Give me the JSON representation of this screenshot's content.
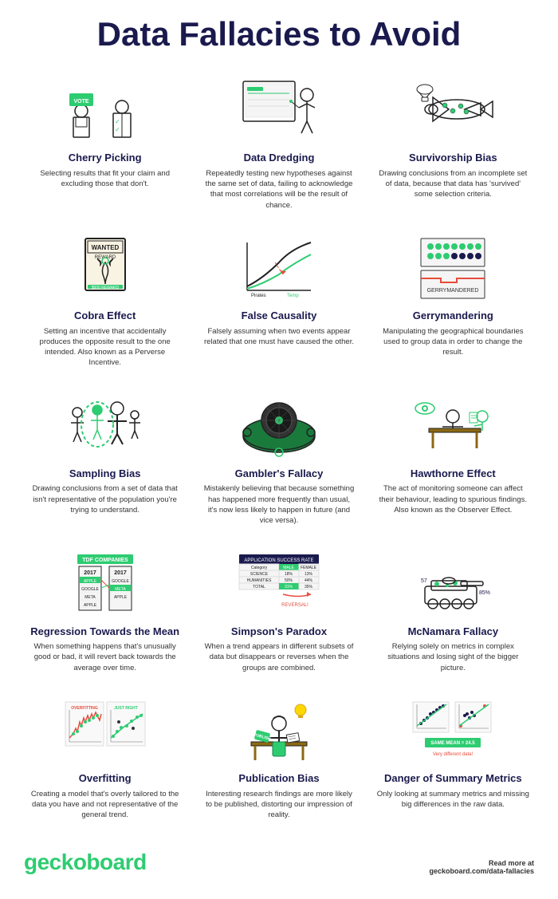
{
  "title": "Data Fallacies to Avoid",
  "cards": [
    {
      "id": "cherry-picking",
      "title": "Cherry Picking",
      "desc": "Selecting results that fit your claim and excluding those that don't."
    },
    {
      "id": "data-dredging",
      "title": "Data Dredging",
      "desc": "Repeatedly testing new hypotheses against the same set of data, failing to acknowledge that most correlations will be the result of chance."
    },
    {
      "id": "survivorship-bias",
      "title": "Survivorship Bias",
      "desc": "Drawing conclusions from an incomplete set of data, because that data has 'survived' some selection criteria."
    },
    {
      "id": "cobra-effect",
      "title": "Cobra Effect",
      "desc": "Setting an incentive that accidentally produces the opposite result to the one intended. Also known as a Perverse Incentive."
    },
    {
      "id": "false-causality",
      "title": "False Causality",
      "desc": "Falsely assuming when two events appear related that one must have caused the other."
    },
    {
      "id": "gerrymandering",
      "title": "Gerrymandering",
      "desc": "Manipulating the geographical boundaries used to group data in order to change the result."
    },
    {
      "id": "sampling-bias",
      "title": "Sampling Bias",
      "desc": "Drawing conclusions from a set of data that isn't representative of the population you're trying to understand."
    },
    {
      "id": "gamblers-fallacy",
      "title": "Gambler's Fallacy",
      "desc": "Mistakenly believing that because something has happened more frequently than usual, it's now less likely to happen in future (and vice versa)."
    },
    {
      "id": "hawthorne-effect",
      "title": "Hawthorne Effect",
      "desc": "The act of monitoring someone can affect their behaviour, leading to spurious findings. Also known as the Observer Effect."
    },
    {
      "id": "regression-mean",
      "title": "Regression Towards the Mean",
      "desc": "When something happens that's unusually good or bad, it will revert back towards the average over time."
    },
    {
      "id": "simpsons-paradox",
      "title": "Simpson's Paradox",
      "desc": "When a trend appears in different subsets of data but disappears or reverses when the groups are combined."
    },
    {
      "id": "mcnamara-fallacy",
      "title": "McNamara Fallacy",
      "desc": "Relying solely on metrics in complex situations and losing sight of the bigger picture."
    },
    {
      "id": "overfitting",
      "title": "Overfitting",
      "desc": "Creating a model that's overly tailored to the data you have and not representative of the general trend."
    },
    {
      "id": "publication-bias",
      "title": "Publication Bias",
      "desc": "Interesting research findings are more likely to be published, distorting our impression of reality."
    },
    {
      "id": "danger-summary",
      "title": "Danger of Summary Metrics",
      "desc": "Only looking at summary metrics and missing big differences in the raw data."
    }
  ],
  "footer": {
    "brand": "geckoboard",
    "read_more_label": "Read more at",
    "read_more_url": "geckoboard.com/data-fallacies"
  }
}
